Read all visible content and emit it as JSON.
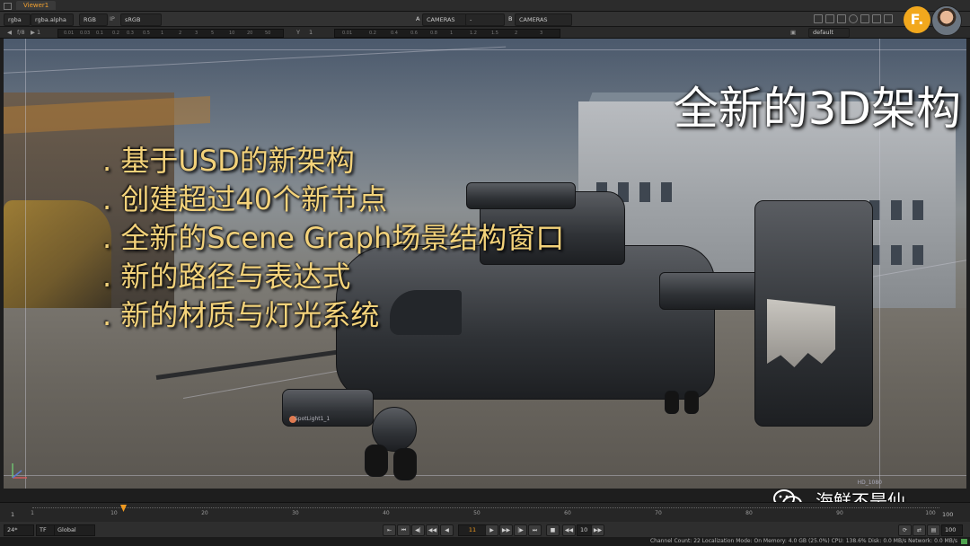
{
  "tabs": {
    "viewer": "Viewer1"
  },
  "toolbar1": {
    "channels": "rgba",
    "alpha": "rgba.alpha",
    "colorspace": "RGB",
    "ip_label": "IP",
    "display": "sRGB",
    "input_a_label": "A",
    "input_a": "CAMERAS",
    "compare_op": "-",
    "input_b_label": "B",
    "input_b": "CAMERAS",
    "view_label": "default"
  },
  "toolbar2": {
    "fstop": "f/8",
    "frame": "1",
    "y_label": "Y",
    "y_value": "1",
    "gain_ticks": [
      "0.01",
      "0.03",
      "0.1",
      "0.2",
      "0.3",
      "0.5",
      "1",
      "2",
      "3",
      "5",
      "10",
      "20",
      "50"
    ],
    "gamma_ticks": [
      "0.01",
      "0.2",
      "0.4",
      "0.6",
      "0.8",
      "1",
      "1.2",
      "1.5",
      "2",
      "3"
    ]
  },
  "overlay": {
    "headline": "全新的3D架构",
    "bullets": [
      ". 基于USD的新架构",
      ". 创建超过40个新节点",
      ". 全新的Scene Graph场景结构窗口",
      ". 新的路径与表达式",
      ". 新的材质与灯光系统"
    ],
    "spotlight_label": "SpotLight1_1",
    "format_label": "HD_1080"
  },
  "logo": {
    "letter": "F."
  },
  "timeline": {
    "start": "1",
    "end": "100",
    "ticks": [
      "1",
      "10",
      "20",
      "30",
      "40",
      "50",
      "60",
      "70",
      "80",
      "90",
      "100"
    ],
    "current_frame": "11"
  },
  "transport": {
    "fps": "24*",
    "tf": "TF",
    "range_mode": "Global",
    "frame": "11",
    "increment": "10",
    "end_frame": "100"
  },
  "status": {
    "text": "Channel Count: 22  Localization Mode: On  Memory: 4.0 GB (25.0%)  CPU: 138.6%  Disk: 0.0 MB/s  Network: 0.0 MB/s"
  },
  "watermark": {
    "text": "海鲜不是仙"
  },
  "colors": {
    "accent": "#f09a20",
    "bullet_text": "#f3d27a",
    "logo": "#f2a81d"
  }
}
